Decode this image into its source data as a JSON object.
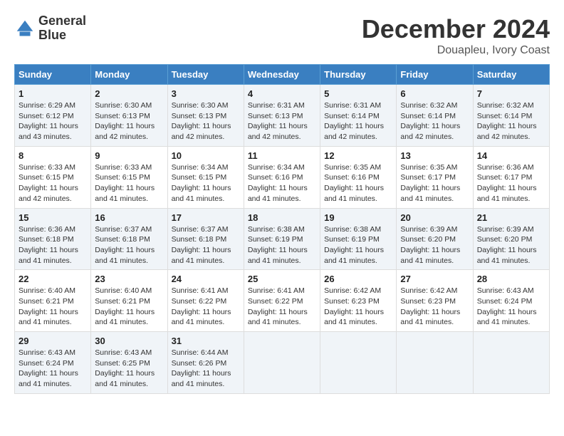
{
  "logo": {
    "line1": "General",
    "line2": "Blue"
  },
  "title": "December 2024",
  "location": "Douapleu, Ivory Coast",
  "days_of_week": [
    "Sunday",
    "Monday",
    "Tuesday",
    "Wednesday",
    "Thursday",
    "Friday",
    "Saturday"
  ],
  "weeks": [
    [
      {
        "day": "1",
        "sunrise": "6:29 AM",
        "sunset": "6:12 PM",
        "daylight": "11 hours and 43 minutes."
      },
      {
        "day": "2",
        "sunrise": "6:30 AM",
        "sunset": "6:13 PM",
        "daylight": "11 hours and 42 minutes."
      },
      {
        "day": "3",
        "sunrise": "6:30 AM",
        "sunset": "6:13 PM",
        "daylight": "11 hours and 42 minutes."
      },
      {
        "day": "4",
        "sunrise": "6:31 AM",
        "sunset": "6:13 PM",
        "daylight": "11 hours and 42 minutes."
      },
      {
        "day": "5",
        "sunrise": "6:31 AM",
        "sunset": "6:14 PM",
        "daylight": "11 hours and 42 minutes."
      },
      {
        "day": "6",
        "sunrise": "6:32 AM",
        "sunset": "6:14 PM",
        "daylight": "11 hours and 42 minutes."
      },
      {
        "day": "7",
        "sunrise": "6:32 AM",
        "sunset": "6:14 PM",
        "daylight": "11 hours and 42 minutes."
      }
    ],
    [
      {
        "day": "8",
        "sunrise": "6:33 AM",
        "sunset": "6:15 PM",
        "daylight": "11 hours and 42 minutes."
      },
      {
        "day": "9",
        "sunrise": "6:33 AM",
        "sunset": "6:15 PM",
        "daylight": "11 hours and 41 minutes."
      },
      {
        "day": "10",
        "sunrise": "6:34 AM",
        "sunset": "6:15 PM",
        "daylight": "11 hours and 41 minutes."
      },
      {
        "day": "11",
        "sunrise": "6:34 AM",
        "sunset": "6:16 PM",
        "daylight": "11 hours and 41 minutes."
      },
      {
        "day": "12",
        "sunrise": "6:35 AM",
        "sunset": "6:16 PM",
        "daylight": "11 hours and 41 minutes."
      },
      {
        "day": "13",
        "sunrise": "6:35 AM",
        "sunset": "6:17 PM",
        "daylight": "11 hours and 41 minutes."
      },
      {
        "day": "14",
        "sunrise": "6:36 AM",
        "sunset": "6:17 PM",
        "daylight": "11 hours and 41 minutes."
      }
    ],
    [
      {
        "day": "15",
        "sunrise": "6:36 AM",
        "sunset": "6:18 PM",
        "daylight": "11 hours and 41 minutes."
      },
      {
        "day": "16",
        "sunrise": "6:37 AM",
        "sunset": "6:18 PM",
        "daylight": "11 hours and 41 minutes."
      },
      {
        "day": "17",
        "sunrise": "6:37 AM",
        "sunset": "6:18 PM",
        "daylight": "11 hours and 41 minutes."
      },
      {
        "day": "18",
        "sunrise": "6:38 AM",
        "sunset": "6:19 PM",
        "daylight": "11 hours and 41 minutes."
      },
      {
        "day": "19",
        "sunrise": "6:38 AM",
        "sunset": "6:19 PM",
        "daylight": "11 hours and 41 minutes."
      },
      {
        "day": "20",
        "sunrise": "6:39 AM",
        "sunset": "6:20 PM",
        "daylight": "11 hours and 41 minutes."
      },
      {
        "day": "21",
        "sunrise": "6:39 AM",
        "sunset": "6:20 PM",
        "daylight": "11 hours and 41 minutes."
      }
    ],
    [
      {
        "day": "22",
        "sunrise": "6:40 AM",
        "sunset": "6:21 PM",
        "daylight": "11 hours and 41 minutes."
      },
      {
        "day": "23",
        "sunrise": "6:40 AM",
        "sunset": "6:21 PM",
        "daylight": "11 hours and 41 minutes."
      },
      {
        "day": "24",
        "sunrise": "6:41 AM",
        "sunset": "6:22 PM",
        "daylight": "11 hours and 41 minutes."
      },
      {
        "day": "25",
        "sunrise": "6:41 AM",
        "sunset": "6:22 PM",
        "daylight": "11 hours and 41 minutes."
      },
      {
        "day": "26",
        "sunrise": "6:42 AM",
        "sunset": "6:23 PM",
        "daylight": "11 hours and 41 minutes."
      },
      {
        "day": "27",
        "sunrise": "6:42 AM",
        "sunset": "6:23 PM",
        "daylight": "11 hours and 41 minutes."
      },
      {
        "day": "28",
        "sunrise": "6:43 AM",
        "sunset": "6:24 PM",
        "daylight": "11 hours and 41 minutes."
      }
    ],
    [
      {
        "day": "29",
        "sunrise": "6:43 AM",
        "sunset": "6:24 PM",
        "daylight": "11 hours and 41 minutes."
      },
      {
        "day": "30",
        "sunrise": "6:43 AM",
        "sunset": "6:25 PM",
        "daylight": "11 hours and 41 minutes."
      },
      {
        "day": "31",
        "sunrise": "6:44 AM",
        "sunset": "6:26 PM",
        "daylight": "11 hours and 41 minutes."
      },
      null,
      null,
      null,
      null
    ]
  ],
  "labels": {
    "sunrise": "Sunrise:",
    "sunset": "Sunset:",
    "daylight": "Daylight:"
  }
}
